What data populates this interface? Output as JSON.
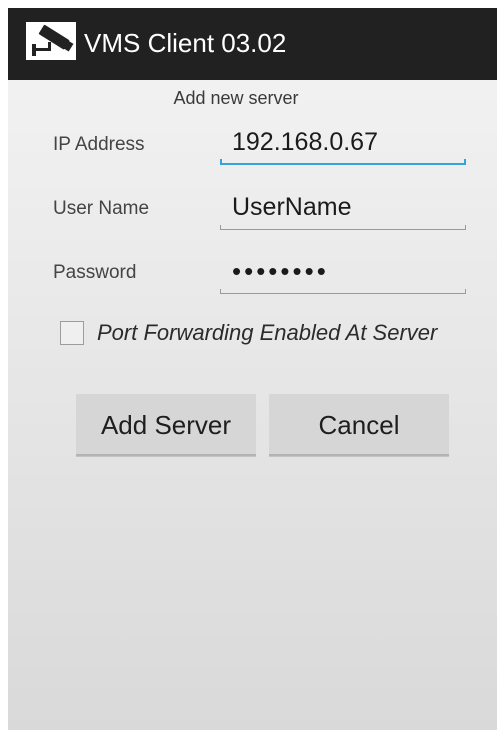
{
  "app": {
    "title": "VMS Client 03.02",
    "icon": "cctv-camera-icon"
  },
  "dialog": {
    "subtitle": "Add new server",
    "fields": {
      "ip_label": "IP Address",
      "ip_value": "192.168.0.67",
      "user_label": "User Name",
      "user_value": "UserName",
      "password_label": "Password",
      "password_value": "••••••••"
    },
    "port_forwarding": {
      "label": "Port Forwarding Enabled At Server",
      "checked": false
    },
    "buttons": {
      "add_label": "Add Server",
      "cancel_label": "Cancel"
    }
  },
  "colors": {
    "titlebar": "#212121",
    "focus_accent": "#33a4d8",
    "button_bg": "#d6d6d6"
  }
}
